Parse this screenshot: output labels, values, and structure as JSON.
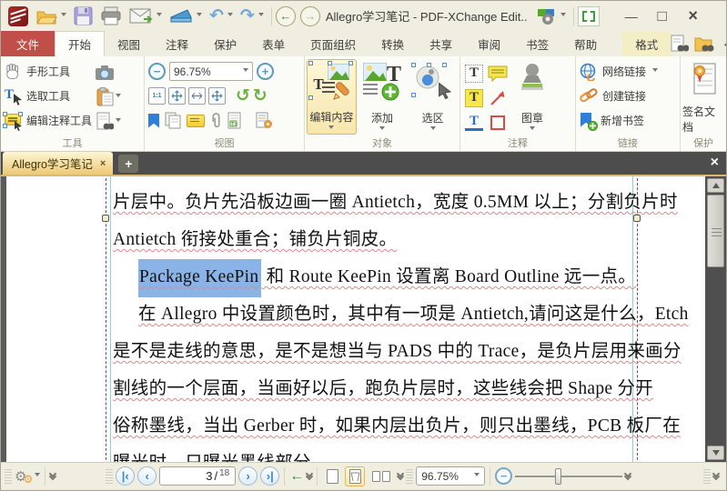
{
  "titlebar": {
    "title": "Allegro学习笔记 - PDF-XChange Edit.."
  },
  "glyphs": {
    "minimize": "—",
    "maximize": "□",
    "close": "×",
    "plus": "+",
    "tab_close": "×",
    "undo": "↶",
    "redo": "↷",
    "back": "←",
    "forward": "→",
    "rotate_ccw": "↺",
    "rotate_cw": "↻",
    "minus": "−",
    "prev": "‹",
    "next": "›",
    "first": "|‹",
    "last": "›|",
    "green_back": "←",
    "one_to_one": "1:1",
    "gear": "⚙"
  },
  "ribbon_tabs": [
    {
      "label": "文件"
    },
    {
      "label": "开始"
    },
    {
      "label": "视图"
    },
    {
      "label": "注释"
    },
    {
      "label": "保护"
    },
    {
      "label": "表单"
    },
    {
      "label": "页面组织"
    },
    {
      "label": "转换"
    },
    {
      "label": "共享"
    },
    {
      "label": "审阅"
    },
    {
      "label": "书签"
    },
    {
      "label": "帮助"
    },
    {
      "label": "格式"
    }
  ],
  "ribbon": {
    "tools": {
      "group_label": "工具",
      "hand": "手形工具",
      "select": "选取工具",
      "edit_annot": "编辑注释工具"
    },
    "view": {
      "group_label": "视图",
      "zoom_value": "96.75%"
    },
    "objects": {
      "group_label": "对象",
      "edit_content": "编辑内容",
      "add": "添加",
      "select_area": "选区"
    },
    "comments": {
      "group_label": "注释",
      "stamp": "图章"
    },
    "links": {
      "group_label": "链接",
      "web_link": "网络链接",
      "create_link": "创建链接",
      "add_bookmark": "新增书签"
    },
    "protect": {
      "group_label": "保护",
      "sign": "签名文档"
    }
  },
  "doc_tab": {
    "title": "Allegro学习笔记"
  },
  "document": {
    "lines": [
      {
        "text": "片层中。负片先沿板边画一圈 Antietch，宽度 0.5MM 以上；分割负片时"
      },
      {
        "text": "Antietch 衔接处重合；铺负片铜皮。"
      },
      {
        "selected": "Package KeePin",
        "text": " 和 Route KeePin 设置离 Board Outline 远一点。"
      },
      {
        "text": "在 Allegro 中设置颜色时，其中有一项是 Antietch,请问这是什么，Etch"
      },
      {
        "text": "是不是走线的意思，是不是想当与 PADS 中的 Trace，是负片层用来画分"
      },
      {
        "text": "割线的一个层面，当画好以后，跑负片层时，这些线会把 Shape 分开"
      },
      {
        "text": "俗称墨线，当出 Gerber 时，如果内层出负片，则只出墨线，PCB 板厂在"
      },
      {
        "text": "曝光时，只曝光墨线部分。"
      }
    ]
  },
  "statusbar": {
    "page_current": "3",
    "page_separator": "/",
    "page_total": "18",
    "zoom_value": "96.75%"
  },
  "colors": {
    "file_tab": "#bf4f48",
    "format_tab": "#f3eec6",
    "doc_tab_gold": "#edc976",
    "selection_blue": "#8ab4e8",
    "squiggle_red": "#dc8a8a",
    "canvas_gray": "#5b5b5b"
  }
}
